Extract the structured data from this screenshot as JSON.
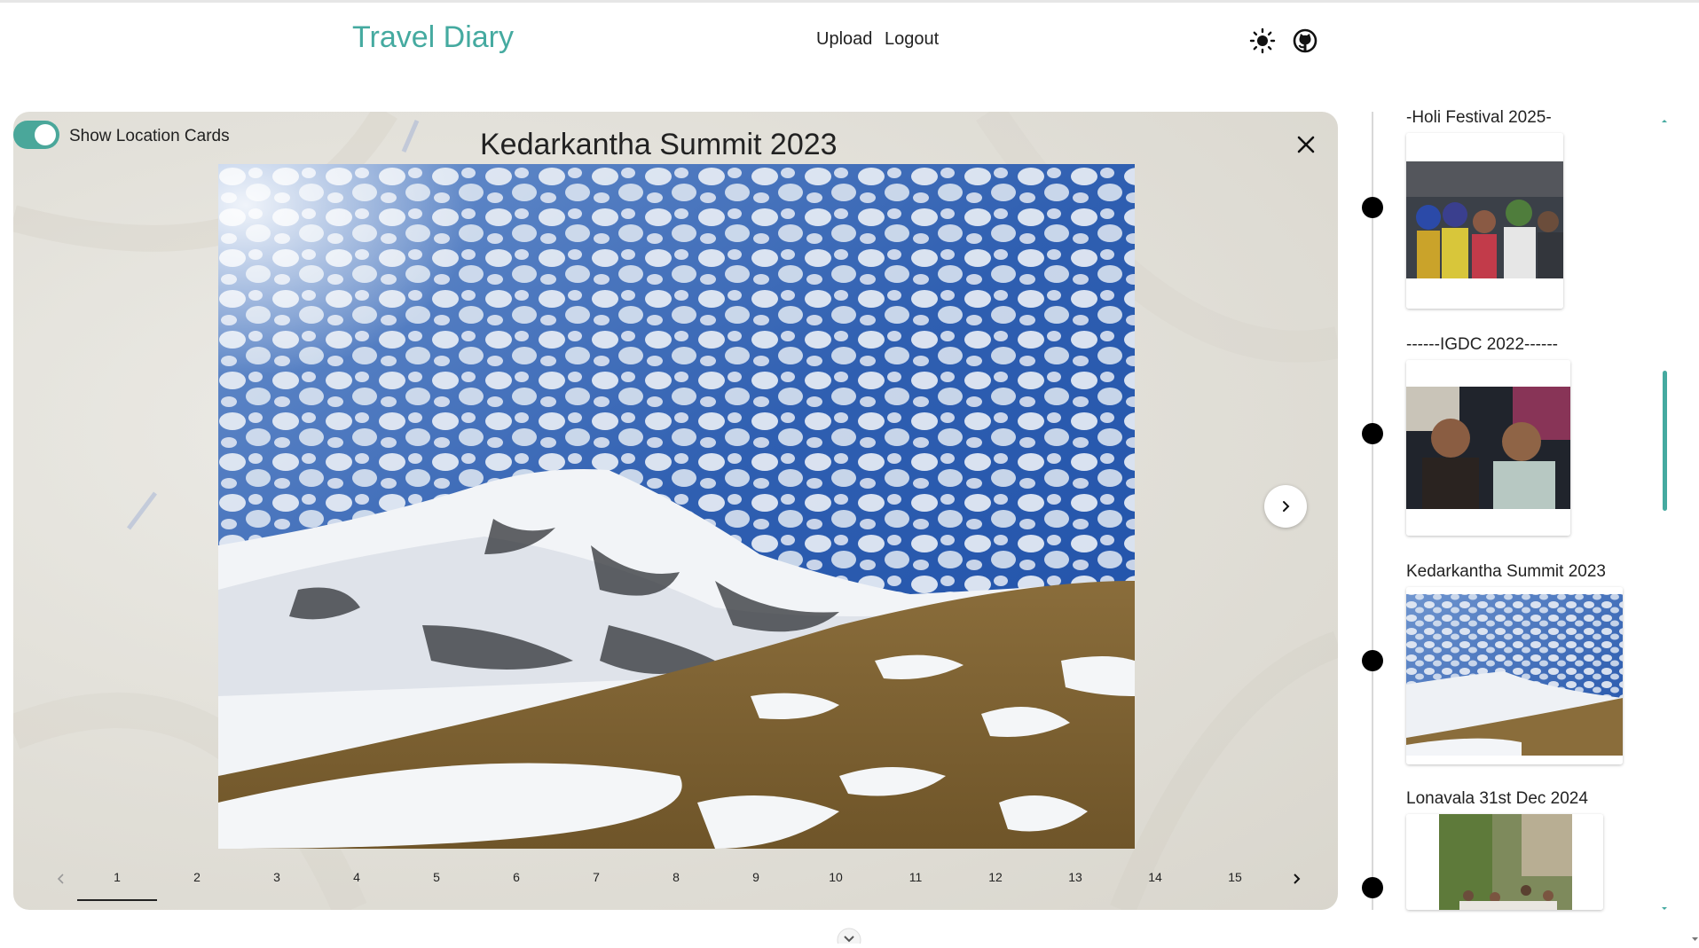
{
  "header": {
    "brand": "Travel Diary",
    "nav": [
      "Upload",
      "Logout"
    ],
    "icons": [
      "theme-toggle-sun-icon",
      "github-icon"
    ],
    "brand_color": "#45aaa0"
  },
  "viewer": {
    "toggle_label": "Show Location Cards",
    "toggle_on": true,
    "title": "Kedarkantha Summit 2023",
    "pages": [
      "1",
      "2",
      "3",
      "4",
      "5",
      "6",
      "7",
      "8",
      "9",
      "10",
      "11",
      "12",
      "13",
      "14",
      "15"
    ],
    "active_page": "1"
  },
  "timeline": {
    "items": [
      {
        "label": "-Holi Festival 2025-"
      },
      {
        "label": "------IGDC 2022------"
      },
      {
        "label": "Kedarkantha Summit 2023"
      },
      {
        "label": "Lonavala 31st Dec 2024"
      }
    ],
    "accent": "#45aaa0"
  }
}
